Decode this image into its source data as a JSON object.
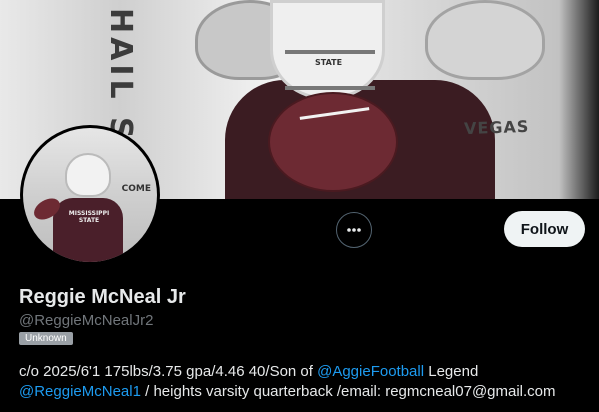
{
  "banner": {
    "wall_text": "HAIL S",
    "sign_text": "VEGAS",
    "helmet_text": "STATE"
  },
  "avatar": {
    "jersey_text": "MISSISSIPPI STATE",
    "sign_text": "COME"
  },
  "actions": {
    "more_icon": "more-horizontal-icon",
    "follow_label": "Follow"
  },
  "profile": {
    "name": "Reggie McNeal Jr",
    "handle": "@ReggieMcNealJr2",
    "badge": "Unknown",
    "bio": {
      "part1": "c/o 2025/6'1 175lbs/3.75 gpa/4.46 40/Son of ",
      "link1": "@AggieFootball",
      "part2": " Legend ",
      "link2": "@ReggieMcNeal1",
      "part3": " / heights varsity quarterback /email: regmcneal07@gmail.com"
    }
  },
  "colors": {
    "background": "#000000",
    "link": "#1d9bf0",
    "muted": "#71767b",
    "follow_bg": "#eff3f4",
    "maroon": "#6d2a33"
  }
}
